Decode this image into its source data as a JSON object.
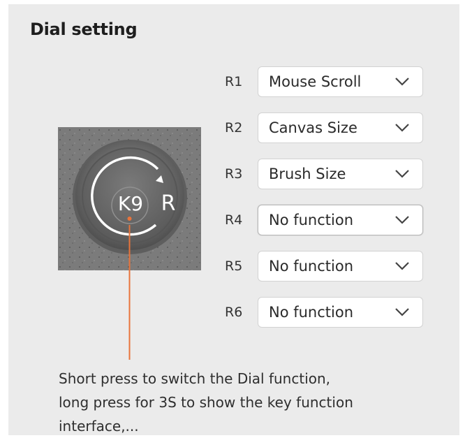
{
  "title": "Dial setting",
  "dial": {
    "key_label": "K9",
    "side_label": "R"
  },
  "rows": [
    {
      "label": "R1",
      "value": "Mouse Scroll"
    },
    {
      "label": "R2",
      "value": "Canvas Size"
    },
    {
      "label": "R3",
      "value": "Brush Size"
    },
    {
      "label": "R4",
      "value": "No function"
    },
    {
      "label": "R5",
      "value": "No function"
    },
    {
      "label": "R6",
      "value": "No function"
    }
  ],
  "caption": {
    "line1": "Short press to switch the Dial function,",
    "line2": "long press for 3S to show the key function",
    "line3": "interface,..."
  },
  "colors": {
    "panel": "#ebebeb",
    "pointer": "#e8743b"
  },
  "icons": {
    "dropdown": "chevron-down-icon",
    "dial": "rotate-arrow-icon"
  }
}
